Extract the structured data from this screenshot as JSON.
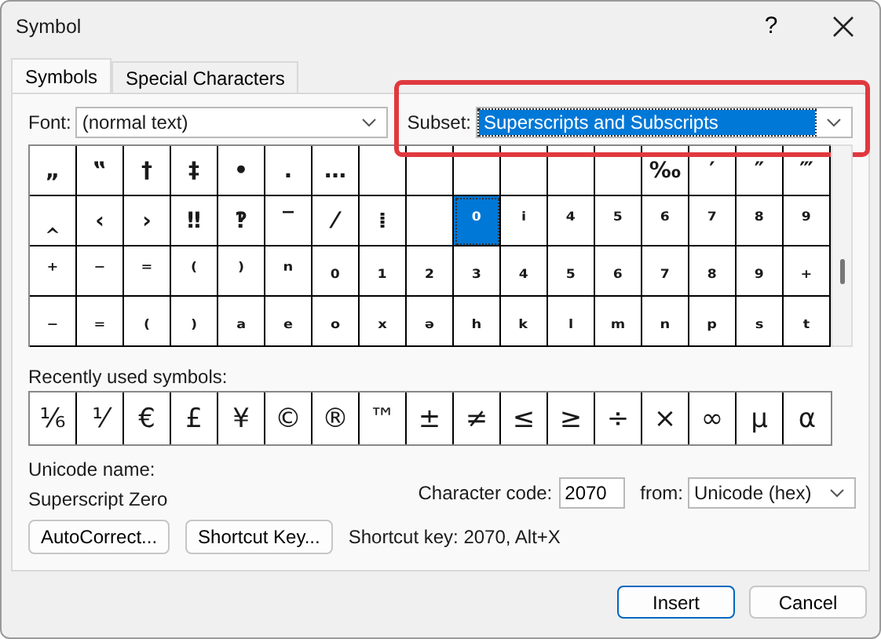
{
  "window": {
    "title": "Symbol",
    "help": "?"
  },
  "tabs": [
    {
      "label": "Symbols",
      "selected": true
    },
    {
      "label": "Special Characters",
      "selected": false
    }
  ],
  "font": {
    "label": "Font:",
    "value": "(normal text)"
  },
  "subset": {
    "label": "Subset:",
    "value": "Superscripts and Subscripts",
    "highlighted": true
  },
  "grid": [
    [
      {
        "kind": "symbol",
        "char": "„",
        "selected": false
      },
      {
        "kind": "symbol",
        "char": "‟",
        "selected": false
      },
      {
        "kind": "symbol",
        "char": "†",
        "selected": false
      },
      {
        "kind": "symbol",
        "char": "‡",
        "selected": false
      },
      {
        "kind": "symbol",
        "char": "•",
        "selected": false
      },
      {
        "kind": "symbol",
        "char": "․",
        "selected": false
      },
      {
        "kind": "symbol",
        "char": "…",
        "selected": false
      },
      {
        "kind": "empty",
        "selected": false
      },
      {
        "kind": "empty",
        "selected": false
      },
      {
        "kind": "empty",
        "selected": false
      },
      {
        "kind": "empty",
        "selected": false
      },
      {
        "kind": "empty",
        "selected": false
      },
      {
        "kind": "empty",
        "selected": false
      },
      {
        "kind": "symbol",
        "char": "‰",
        "selected": false
      },
      {
        "kind": "symbol",
        "char": "′",
        "selected": false
      },
      {
        "kind": "symbol",
        "char": "″",
        "selected": false
      },
      {
        "kind": "symbol",
        "char": "‴",
        "selected": false
      }
    ],
    [
      {
        "kind": "symbol",
        "char": "‸",
        "selected": false
      },
      {
        "kind": "symbol",
        "char": "‹",
        "selected": false
      },
      {
        "kind": "symbol",
        "char": "›",
        "selected": false
      },
      {
        "kind": "symbol",
        "char": "‼",
        "selected": false
      },
      {
        "kind": "symbol",
        "char": "‽",
        "selected": false
      },
      {
        "kind": "symbol",
        "char": "‾",
        "selected": false
      },
      {
        "kind": "symbol",
        "char": "⁄",
        "selected": false
      },
      {
        "kind": "symbol",
        "char": "⁞",
        "selected": false
      },
      {
        "kind": "empty",
        "selected": false
      },
      {
        "kind": "symbol",
        "char": "⁰",
        "selected": true
      },
      {
        "kind": "symbol",
        "char": "ⁱ",
        "selected": false
      },
      {
        "kind": "symbol",
        "char": "⁴",
        "selected": false
      },
      {
        "kind": "symbol",
        "char": "⁵",
        "selected": false
      },
      {
        "kind": "symbol",
        "char": "⁶",
        "selected": false
      },
      {
        "kind": "symbol",
        "char": "⁷",
        "selected": false
      },
      {
        "kind": "symbol",
        "char": "⁸",
        "selected": false
      },
      {
        "kind": "symbol",
        "char": "⁹",
        "selected": false
      }
    ],
    [
      {
        "kind": "symbol",
        "char": "⁺",
        "selected": false
      },
      {
        "kind": "symbol",
        "char": "⁻",
        "selected": false
      },
      {
        "kind": "symbol",
        "char": "⁼",
        "selected": false
      },
      {
        "kind": "symbol",
        "char": "⁽",
        "selected": false
      },
      {
        "kind": "symbol",
        "char": "⁾",
        "selected": false
      },
      {
        "kind": "symbol",
        "char": "ⁿ",
        "selected": false
      },
      {
        "kind": "symbol",
        "char": "₀",
        "selected": false
      },
      {
        "kind": "symbol",
        "char": "₁",
        "selected": false
      },
      {
        "kind": "symbol",
        "char": "₂",
        "selected": false
      },
      {
        "kind": "symbol",
        "char": "₃",
        "selected": false
      },
      {
        "kind": "symbol",
        "char": "₄",
        "selected": false
      },
      {
        "kind": "symbol",
        "char": "₅",
        "selected": false
      },
      {
        "kind": "symbol",
        "char": "₆",
        "selected": false
      },
      {
        "kind": "symbol",
        "char": "₇",
        "selected": false
      },
      {
        "kind": "symbol",
        "char": "₈",
        "selected": false
      },
      {
        "kind": "symbol",
        "char": "₉",
        "selected": false
      },
      {
        "kind": "symbol",
        "char": "₊",
        "selected": false
      }
    ],
    [
      {
        "kind": "symbol",
        "char": "₋",
        "selected": false
      },
      {
        "kind": "symbol",
        "char": "₌",
        "selected": false
      },
      {
        "kind": "symbol",
        "char": "₍",
        "selected": false
      },
      {
        "kind": "symbol",
        "char": "₎",
        "selected": false
      },
      {
        "kind": "symbol",
        "char": "ₐ",
        "selected": false
      },
      {
        "kind": "symbol",
        "char": "ₑ",
        "selected": false
      },
      {
        "kind": "symbol",
        "char": "ₒ",
        "selected": false
      },
      {
        "kind": "symbol",
        "char": "ₓ",
        "selected": false
      },
      {
        "kind": "symbol",
        "char": "ₔ",
        "selected": false
      },
      {
        "kind": "symbol",
        "char": "ₕ",
        "selected": false
      },
      {
        "kind": "symbol",
        "char": "ₖ",
        "selected": false
      },
      {
        "kind": "symbol",
        "char": "ₗ",
        "selected": false
      },
      {
        "kind": "symbol",
        "char": "ₘ",
        "selected": false
      },
      {
        "kind": "symbol",
        "char": "ₙ",
        "selected": false
      },
      {
        "kind": "symbol",
        "char": "ₚ",
        "selected": false
      },
      {
        "kind": "symbol",
        "char": "ₛ",
        "selected": false
      },
      {
        "kind": "symbol",
        "char": "ₜ",
        "selected": false
      }
    ]
  ],
  "recent": {
    "label": "Recently used symbols:",
    "symbols": [
      "⅙",
      "⅟",
      "€",
      "£",
      "¥",
      "©",
      "®",
      "™",
      "±",
      "≠",
      "≤",
      "≥",
      "÷",
      "×",
      "∞",
      "µ",
      "α"
    ]
  },
  "unicode_name": {
    "label": "Unicode name:",
    "value": "Superscript Zero"
  },
  "character_code": {
    "label": "Character code:",
    "value": "2070"
  },
  "from": {
    "label": "from:",
    "value": "Unicode (hex)"
  },
  "buttons": [
    "AutoCorrect...",
    "Shortcut Key..."
  ],
  "shortcut_text": "Shortcut key: 2070, Alt+X",
  "dialog_buttons": [
    {
      "label": "Insert",
      "default": true
    },
    {
      "label": "Cancel",
      "default": false
    }
  ]
}
